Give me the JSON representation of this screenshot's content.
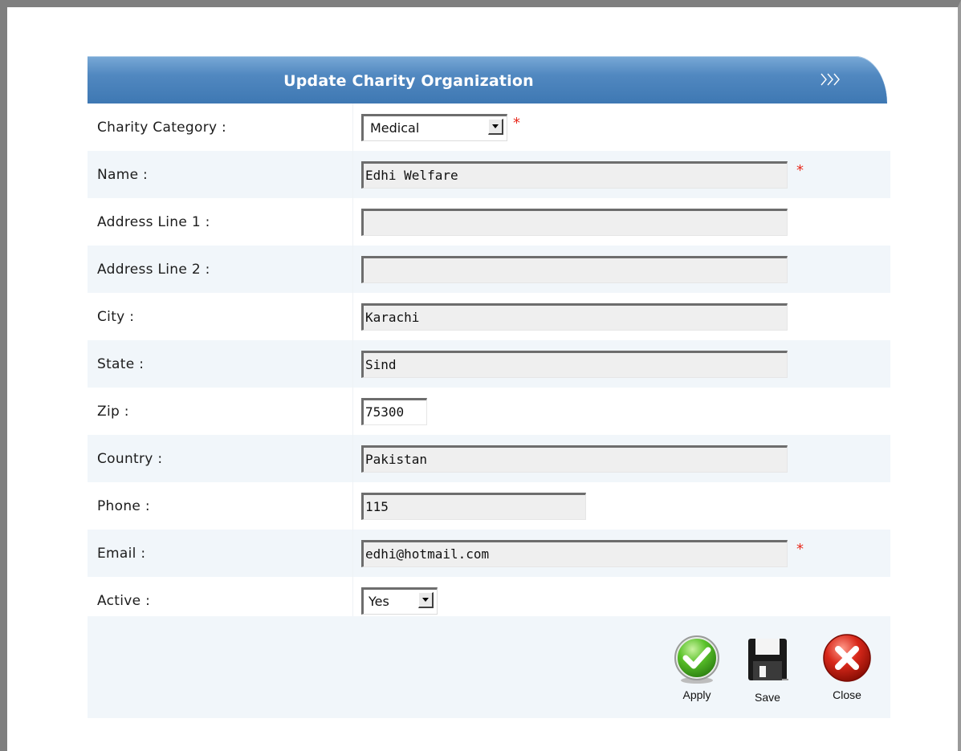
{
  "form": {
    "title": "Update Charity Organization",
    "required_marker": "*",
    "fields": {
      "category": {
        "label": "Charity Category :",
        "value": "Medical"
      },
      "name": {
        "label": "Name :",
        "value": "Edhi Welfare"
      },
      "address1": {
        "label": "Address Line 1 :",
        "value": ""
      },
      "address2": {
        "label": "Address Line 2 :",
        "value": ""
      },
      "city": {
        "label": "City :",
        "value": "Karachi"
      },
      "state": {
        "label": "State :",
        "value": "Sind"
      },
      "zip": {
        "label": "Zip :",
        "value": "75300"
      },
      "country": {
        "label": "Country :",
        "value": "Pakistan"
      },
      "phone": {
        "label": "Phone :",
        "value": "115"
      },
      "email": {
        "label": "Email :",
        "value": "edhi@hotmail.com"
      },
      "active": {
        "label": "Active :",
        "value": "Yes"
      }
    },
    "buttons": {
      "apply": "Apply",
      "save": "Save",
      "close": "Close"
    }
  },
  "colors": {
    "header": "#4a84bf",
    "row_alt": "#f1f6fa",
    "required": "#e8291c"
  },
  "icons": {
    "header": "triple-chevron-right-icon",
    "apply": "green-check-icon",
    "save": "floppy-disk-icon",
    "close": "red-x-icon"
  }
}
